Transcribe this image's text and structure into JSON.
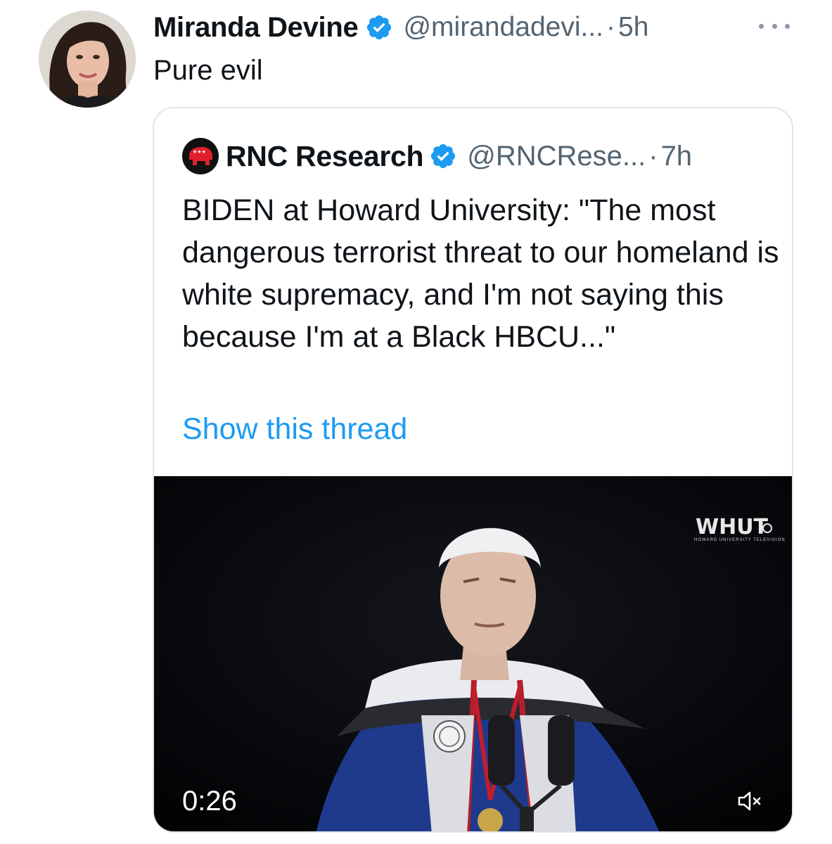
{
  "author": {
    "display_name": "Miranda Devine",
    "handle": "@mirandadevi...",
    "separator": "·",
    "time": "5h",
    "verified": true,
    "avatar_icon": "avatar-photo"
  },
  "tweet": {
    "text": "Pure evil"
  },
  "more_icon": "more-horizontal-icon",
  "quoted_tweet": {
    "author": {
      "display_name": "RNC Research",
      "handle": "@RNCRese...",
      "separator": "·",
      "time": "7h",
      "verified": true,
      "avatar_icon": "republican-elephant-logo"
    },
    "text": "BIDEN at Howard University: \"The most dangerous terrorist threat to our homeland is white supremacy, and I'm not saying this because I'm at a Black HBCU...\"",
    "show_thread_label": "Show this thread",
    "media": {
      "type": "video",
      "duration": "0:26",
      "watermark": "WHUT",
      "watermark_caption": "HOWARD UNIVERSITY TELEVISION",
      "mute_icon": "speaker-muted-icon"
    }
  },
  "colors": {
    "text": "#0f1419",
    "secondary": "#536471",
    "link": "#1d9bf0",
    "verified": "#1d9bf0",
    "border": "#e1e6ea",
    "video_bg": "#050608"
  }
}
